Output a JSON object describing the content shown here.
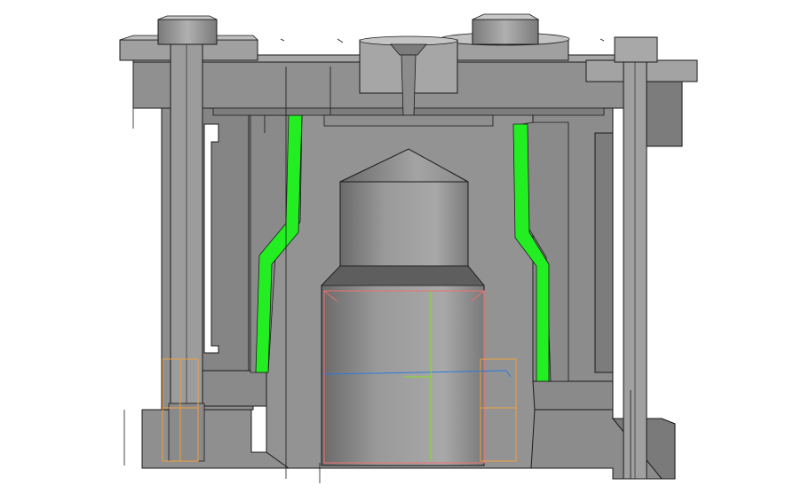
{
  "viewport": {
    "background": "#ffffff",
    "model": {
      "type": "cad-section-view",
      "shading": "gray",
      "colors": {
        "body": "#8c8c8c",
        "body_light": "#a6a6a6",
        "body_dark": "#6e6e6e",
        "edge": "#1a1a1a",
        "cavity": "#ffffff",
        "green_channel": "#22ee22",
        "orange_wireframe": "#f0a040",
        "red_wireframe": "#f07070",
        "blue_axis": "#2a7be0",
        "green_axis": "#88dd22"
      },
      "icons": [
        "bolt-left-icon",
        "bolt-right-icon",
        "screw-right-icon"
      ]
    }
  }
}
